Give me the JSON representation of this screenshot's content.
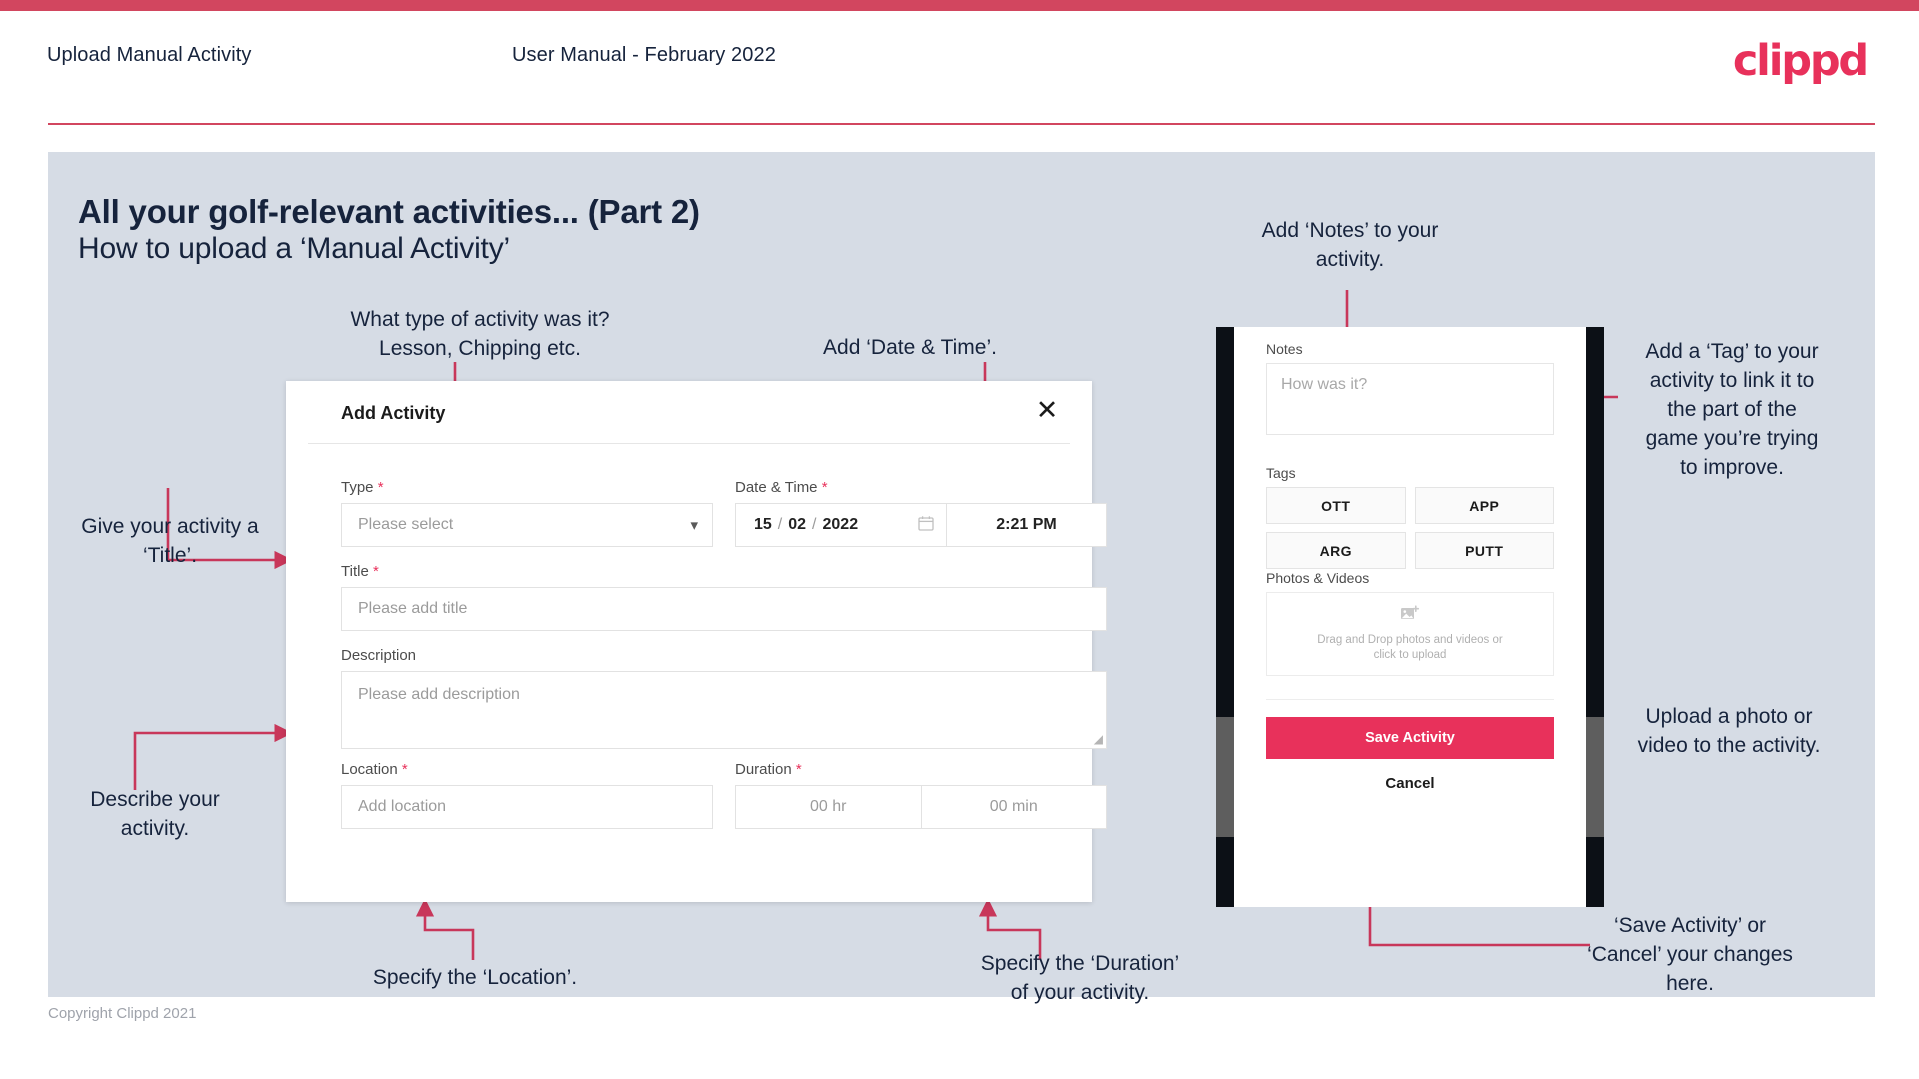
{
  "header": {
    "title": "Upload Manual Activity",
    "subtitle": "User Manual - February 2022",
    "logo": "clippd"
  },
  "slide": {
    "title": "All your golf-relevant activities... (Part 2)",
    "subtitle": "How to upload a ‘Manual Activity’"
  },
  "annotations": {
    "type": "What type of activity was it?\nLesson, Chipping etc.",
    "datetime": "Add ‘Date & Time’.",
    "notes": "Add ‘Notes’ to your\nactivity.",
    "tag": "Add a ‘Tag’ to your\nactivity to link it to\nthe part of the\ngame you’re trying\nto improve.",
    "title_field": "Give your activity a\n‘Title’.",
    "description": "Describe your\nactivity.",
    "upload": "Upload a photo or\nvideo to the activity.",
    "location": "Specify the ‘Location’.",
    "duration": "Specify the ‘Duration’\nof your activity.",
    "save_cancel": "‘Save Activity’ or\n‘Cancel’ your changes\nhere."
  },
  "dialog": {
    "title": "Add Activity",
    "close_icon": "close-icon",
    "fields": {
      "type": {
        "label": "Type",
        "required": "*",
        "placeholder": "Please select",
        "chevron": "chevron-down-icon"
      },
      "datetime": {
        "label": "Date & Time",
        "required": "*",
        "day": "15",
        "month": "02",
        "year": "2022",
        "sep": "/",
        "time": "2:21 PM",
        "calendar_icon": "calendar-icon"
      },
      "title": {
        "label": "Title",
        "required": "*",
        "placeholder": "Please add title"
      },
      "description": {
        "label": "Description",
        "required": "",
        "placeholder": "Please add description"
      },
      "location": {
        "label": "Location",
        "required": "*",
        "placeholder": "Add location"
      },
      "duration": {
        "label": "Duration",
        "required": "*",
        "hours_placeholder": "00 hr",
        "minutes_placeholder": "00 min"
      }
    }
  },
  "phone": {
    "notes": {
      "label": "Notes",
      "placeholder": "How was it?"
    },
    "tags": {
      "label": "Tags",
      "items": [
        "OTT",
        "APP",
        "ARG",
        "PUTT"
      ]
    },
    "photos": {
      "label": "Photos & Videos",
      "dropzone_line1": "Drag and Drop photos and videos or",
      "dropzone_line2": "click to upload",
      "icon": "add-image-icon"
    },
    "save_label": "Save Activity",
    "cancel_label": "Cancel"
  },
  "footer": {
    "copyright": "Copyright Clippd 2021"
  },
  "colors": {
    "accent": "#e8315b",
    "bar": "#d2465f",
    "slide_bg": "#d6dce5",
    "ink": "#16233c",
    "connector": "#c8375a"
  }
}
